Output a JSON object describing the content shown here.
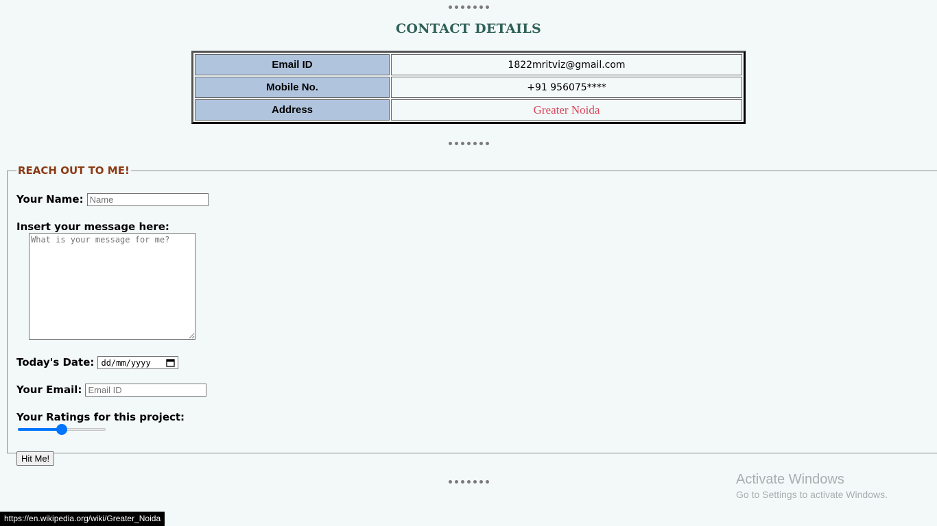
{
  "separator": "•••••••",
  "page_title": "CONTACT DETAILS",
  "contact_table": [
    {
      "key": "Email ID",
      "value": "1822mritviz@gmail.com",
      "is_link": false
    },
    {
      "key": "Mobile No.",
      "value": "+91 956075****",
      "is_link": false
    },
    {
      "key": "Address",
      "value": "Greater Noida",
      "is_link": true
    }
  ],
  "form": {
    "legend": "REACH OUT TO ME!",
    "name_label": "Your Name:",
    "name_placeholder": "Name",
    "message_label": "Insert your message here:",
    "message_placeholder": "What is your message for me?",
    "date_label": "Today's Date:",
    "date_placeholder": "dd/mm/yyyy",
    "email_label": "Your Email:",
    "email_placeholder": "Email ID",
    "ratings_label": "Your Ratings for this project:",
    "rating_value_fraction": 0.5,
    "submit_label": "Hit Me!"
  },
  "watermark": {
    "line1": "Activate Windows",
    "line2": "Go to Settings to activate Windows."
  },
  "status_url": "https://en.wikipedia.org/wiki/Greater_Noida",
  "colors": {
    "title": "#2e6158",
    "legend": "#8b3a15",
    "table_key_bg": "#b0c4de",
    "link": "#d9475a",
    "slider": "#0075ff"
  }
}
